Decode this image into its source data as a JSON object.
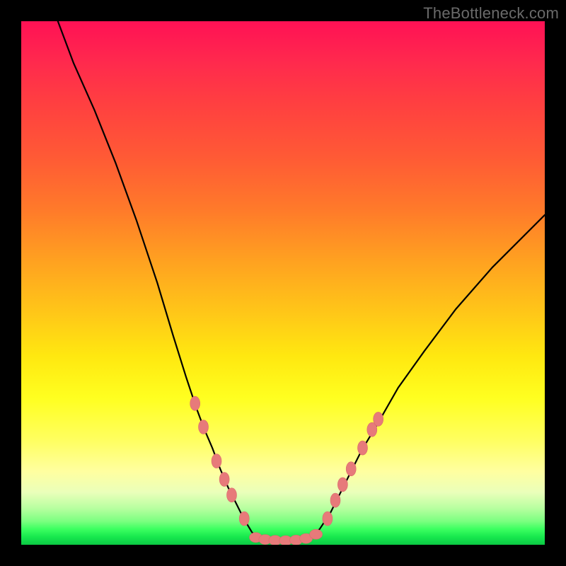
{
  "watermark": "TheBottleneck.com",
  "chart_data": {
    "type": "line",
    "title": "",
    "xlabel": "",
    "ylabel": "",
    "xlim": [
      0,
      100
    ],
    "ylim": [
      0,
      100
    ],
    "series": [
      {
        "name": "curve-left",
        "x": [
          7,
          10,
          14,
          18,
          22,
          26,
          29,
          31.5,
          33.5,
          35,
          36.5,
          38,
          39.5,
          41,
          42.5,
          44,
          45
        ],
        "y": [
          100,
          92,
          83,
          73,
          62,
          50,
          40,
          32,
          26,
          22,
          18.5,
          14.5,
          11,
          8,
          5,
          2.5,
          1.2
        ]
      },
      {
        "name": "curve-flat",
        "x": [
          45,
          47,
          49,
          51,
          53,
          55
        ],
        "y": [
          1.2,
          0.9,
          0.8,
          0.8,
          0.9,
          1.2
        ]
      },
      {
        "name": "curve-right",
        "x": [
          55,
          57,
          59,
          61,
          63,
          65,
          68,
          72,
          77,
          83,
          90,
          100
        ],
        "y": [
          1.2,
          3,
          6,
          10,
          14,
          18,
          23,
          30,
          37,
          45,
          53,
          63
        ]
      }
    ],
    "markers_left": [
      {
        "x": 33.2,
        "y": 27
      },
      {
        "x": 34.8,
        "y": 22.5
      },
      {
        "x": 37.3,
        "y": 16
      },
      {
        "x": 38.8,
        "y": 12.5
      },
      {
        "x": 40.2,
        "y": 9.5
      },
      {
        "x": 42.6,
        "y": 5
      }
    ],
    "markers_right": [
      {
        "x": 58.5,
        "y": 5
      },
      {
        "x": 60.0,
        "y": 8.5
      },
      {
        "x": 61.4,
        "y": 11.5
      },
      {
        "x": 63.0,
        "y": 14.5
      },
      {
        "x": 65.2,
        "y": 18.5
      },
      {
        "x": 67.0,
        "y": 22
      },
      {
        "x": 68.2,
        "y": 24
      }
    ],
    "markers_bottom": [
      {
        "x": 44.8,
        "y": 1.4
      },
      {
        "x": 46.6,
        "y": 1.0
      },
      {
        "x": 48.5,
        "y": 0.85
      },
      {
        "x": 50.5,
        "y": 0.8
      },
      {
        "x": 52.5,
        "y": 0.9
      },
      {
        "x": 54.4,
        "y": 1.2
      },
      {
        "x": 56.3,
        "y": 2.0
      }
    ],
    "colors": {
      "curve": "#000000",
      "marker_fill": "#e77a7a",
      "marker_stroke": "#d96a6a"
    }
  }
}
